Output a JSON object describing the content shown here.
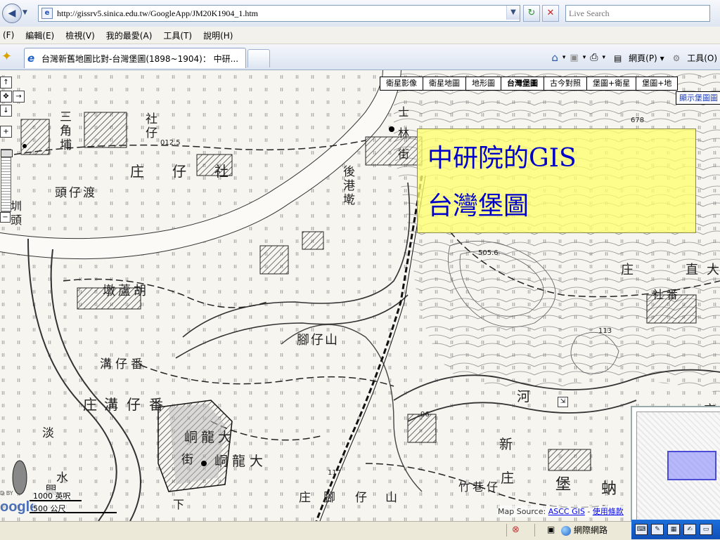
{
  "browser": {
    "url": "http://gissrv5.sinica.edu.tw/GoogleApp/JM20K1904_1.htm",
    "search_placeholder": "Live Search",
    "menu": [
      "(F)",
      "編輯(E)",
      "檢視(V)",
      "我的最愛(A)",
      "工具(T)",
      "說明(H)"
    ],
    "tab_title": "台灣新舊地圖比對-台灣堡圖(1898~1904)： 中研...",
    "cmd_page": "網頁(P)",
    "cmd_tools": "工具(O)"
  },
  "map": {
    "types": [
      "衛星影像",
      "衛星地圖",
      "地形圖",
      "台灣堡圖",
      "古今對照",
      "堡圖+衛星",
      "堡圖+地"
    ],
    "active_type": "台灣堡圖",
    "show_layer": "顯示堡圖圖",
    "callout": {
      "line1": "中研院的GIS",
      "line2": "台灣堡圖"
    },
    "labels": {
      "l1": "三",
      "l2": "角",
      "l3": "埔",
      "l4": "社",
      "l5": "仔",
      "l6": "庄",
      "l7": "仔",
      "l8": "社",
      "l9": "渡",
      "l10": "仔",
      "l11": "頭",
      "l12": "後",
      "l13": "港",
      "l14": "墘",
      "l15": "胡",
      "l16": "蘆",
      "l17": "墩",
      "l18": "山",
      "l19": "仔",
      "l20": "腳",
      "l21": "番",
      "l22": "仔",
      "l23": "溝",
      "l24": "庄",
      "l25": "溝",
      "l26": "仔",
      "l27": "番",
      "l28": "大",
      "l29": "龍",
      "l30": "峒",
      "l31": "街",
      "l32": "大",
      "l33": "龍",
      "l34": "峒",
      "l35": "新",
      "l36": "庄",
      "l37": "仔",
      "l38": "巷",
      "l39": "竹",
      "l40": "堡",
      "l41": "蚋",
      "l42": "河",
      "l43": "庄",
      "l44": "大",
      "l45": "直",
      "l46": "番",
      "l47": "社",
      "l48": "庄",
      "l49": "林",
      "l50": "士",
      "l51": "街",
      "l52": "淡",
      "l53": "水",
      "l54": "興",
      "l55": "腳",
      "l56": "仔",
      "l57": "山",
      "l58": "庄",
      "l59": "下",
      "l60": "圳",
      "l61": "頭"
    },
    "elevations": [
      "012.5",
      "678",
      "505.6",
      "113",
      "96",
      "117"
    ],
    "scale": {
      "top": "1000 英呎",
      "bottom": "500 公尺"
    },
    "powered_by": "D BY",
    "google": "oogle",
    "attribution_prefix": "Map Source: ",
    "attribution_link1": "ASCC GIS",
    "attribution_sep": " - ",
    "attribution_link2": "使用條款"
  },
  "status": {
    "zone": "網際網路"
  }
}
